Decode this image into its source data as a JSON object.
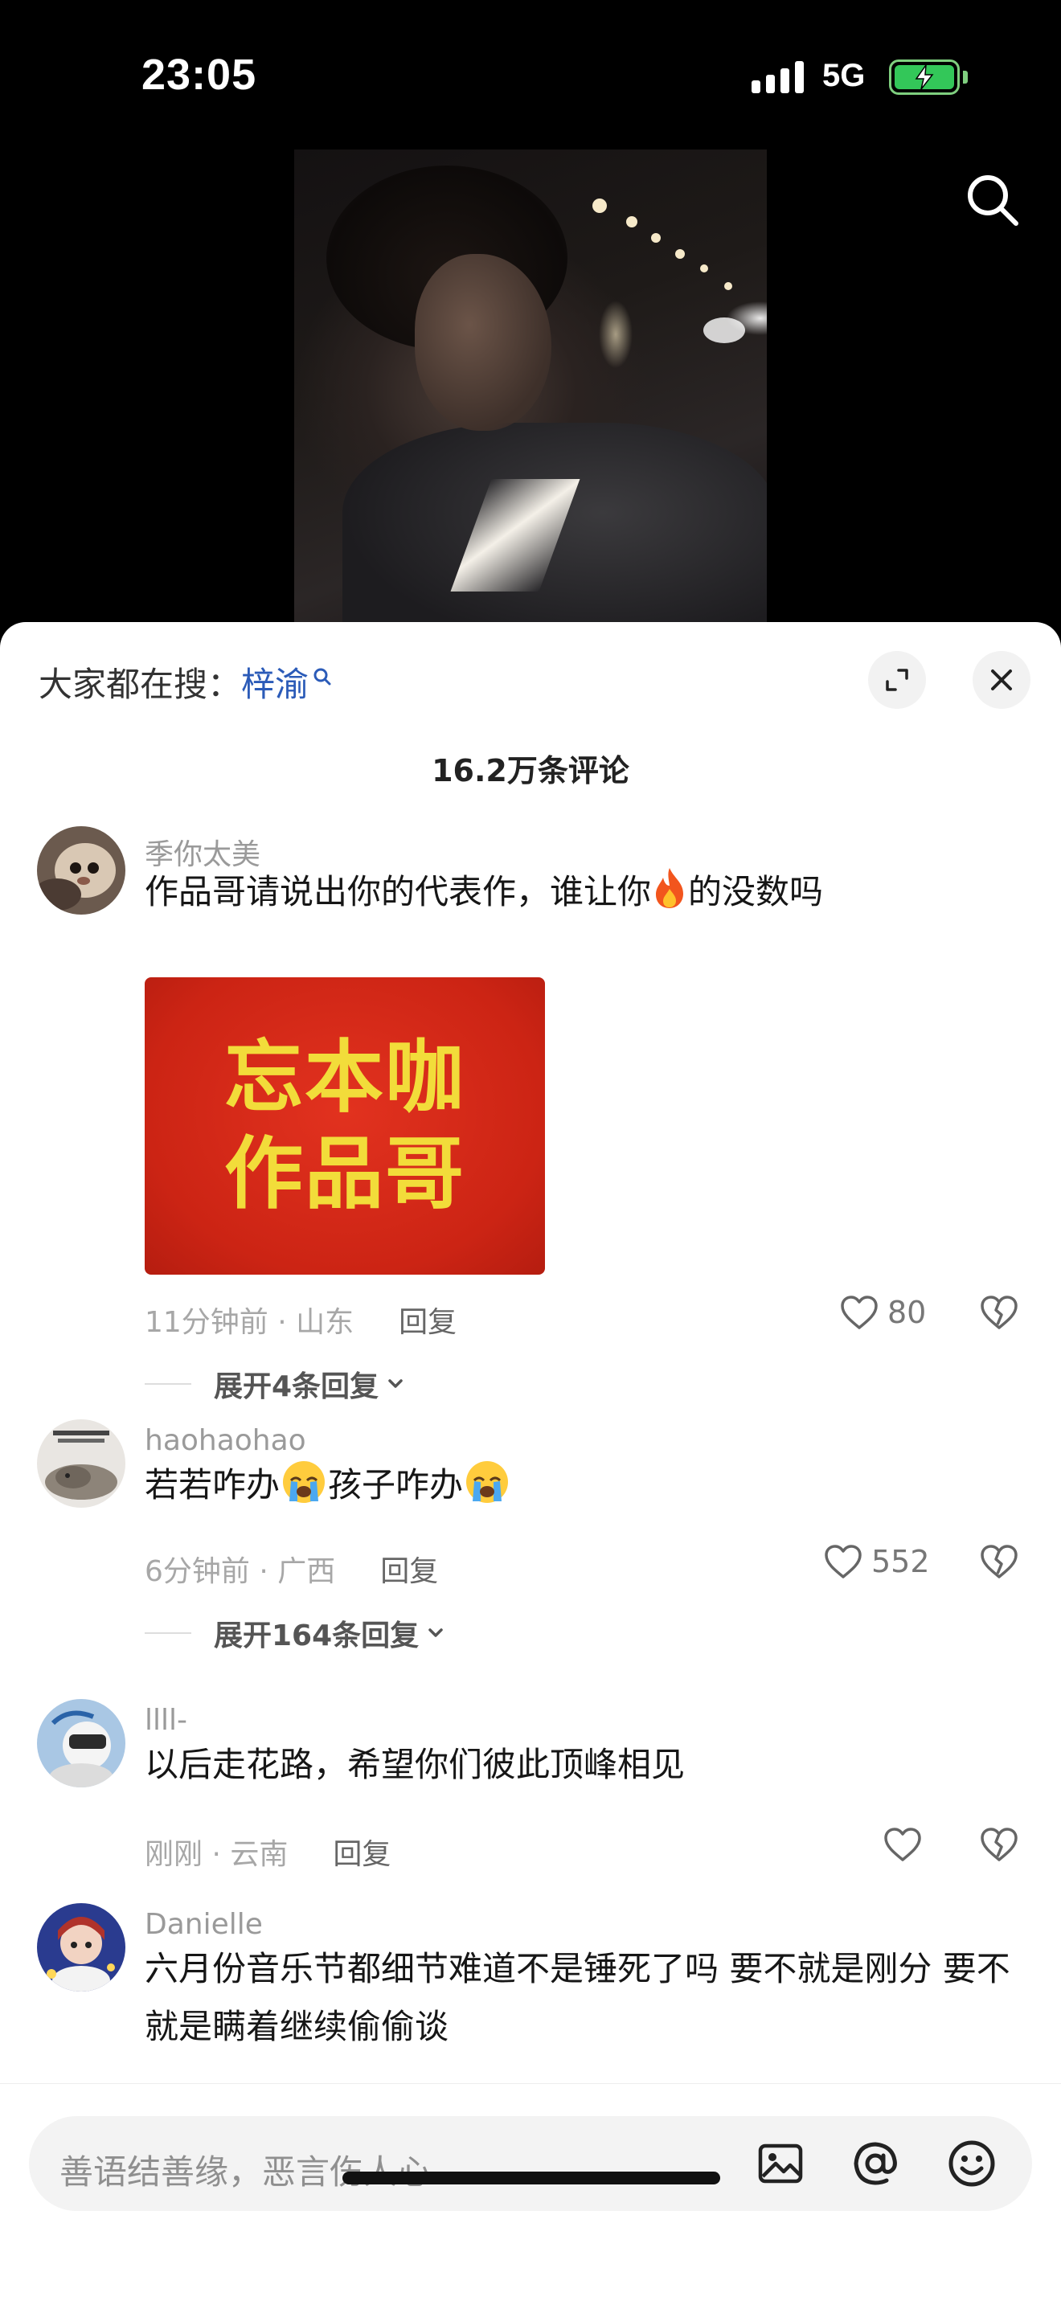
{
  "status_bar": {
    "time": "23:05",
    "network": "5G"
  },
  "sheet": {
    "hot_search_prefix": "大家都在搜：",
    "hot_search_keyword": "梓渝",
    "comment_count": "16.2万条评论"
  },
  "comments": [
    {
      "username": "季你太美",
      "text_before_emoji": "作品哥请说出你的代表作，谁让你",
      "text_after_emoji": "的没数吗",
      "sticker_lines": [
        "忘本咖",
        "作品哥"
      ],
      "time_location": "11分钟前 · 山东",
      "reply_label": "回复",
      "likes": "80",
      "expand_label": "展开4条回复"
    },
    {
      "username": "haohaohao",
      "text_part1": "若若咋办",
      "text_part2": "孩子咋办",
      "time_location": "6分钟前 · 广西",
      "reply_label": "回复",
      "likes": "552",
      "expand_label": "展开164条回复"
    },
    {
      "username": "llll-",
      "text": "以后走花路，希望你们彼此顶峰相见",
      "time_location": "刚刚 · 云南",
      "reply_label": "回复"
    },
    {
      "username": "Danielle",
      "text": "六月份音乐节都细节难道不是锤死了吗 要不就是刚分 要不就是瞒着继续偷偷谈"
    }
  ],
  "input": {
    "placeholder": "善语结善缘，恶言伤人心"
  },
  "icons": [
    "search-icon",
    "expand-icon",
    "close-icon",
    "heart-icon",
    "broken-heart-icon",
    "chevron-down-icon",
    "image-icon",
    "at-icon",
    "emoji-icon",
    "fire-emoji",
    "crying-emoji"
  ],
  "colors": {
    "keyword": "#2b5bb8",
    "sticker_bg": "#d32a18",
    "sticker_text": "#f2dc3a",
    "battery": "#33c759"
  }
}
